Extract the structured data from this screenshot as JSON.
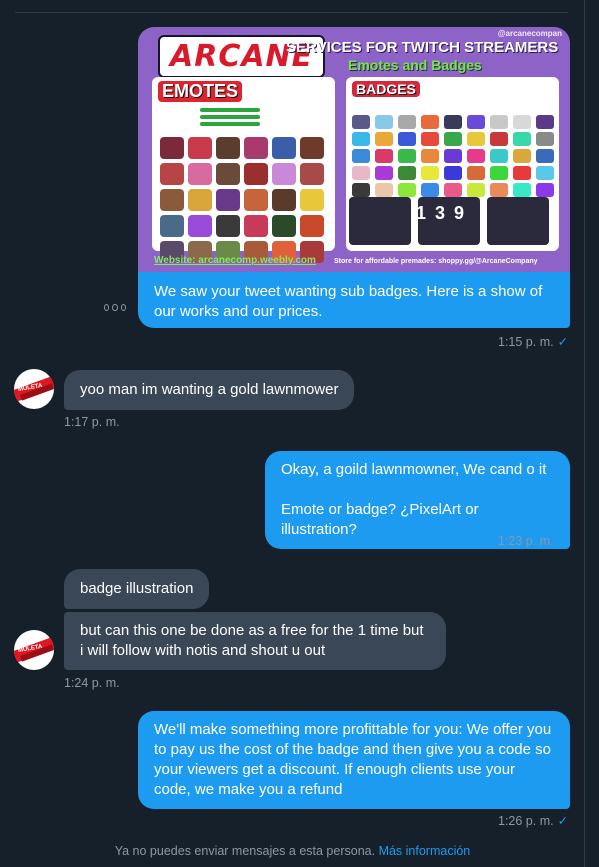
{
  "media": {
    "handle": "@arcanecompan",
    "logo_text": "ARCANE",
    "tagline": "SERVICES FOR TWITCH STREAMERS",
    "subtitle": "Emotes and Badges",
    "emotes_title": "EMOTES",
    "badges_title": "BADGES",
    "pack_numbers": "1 3 9",
    "website": "Website: arcanecomp.weebly.com",
    "store_note": "Store for affordable premades: shoppy.gg/@ArcaneCompany"
  },
  "conversation": [
    {
      "id": "m1",
      "sender": "me",
      "text": "We saw your tweet wanting sub badges. Here is a show of our works and our prices.",
      "time": "1:15 p. m."
    },
    {
      "id": "m2",
      "sender": "them",
      "text": "yoo man im wanting a gold lawnmower",
      "time": "1:17 p. m."
    },
    {
      "id": "m3",
      "sender": "me",
      "line1": "Okay, a goild lawnmowner, We cand o it",
      "line2": "Emote or badge? ¿PixelArt or illustration?",
      "time": "1:23 p. m."
    },
    {
      "id": "m4",
      "sender": "them",
      "text": "badge illustration"
    },
    {
      "id": "m5",
      "sender": "them",
      "text": "but can this one be done as a free for the 1 time but i will follow with notis and shout u out",
      "time": "1:24 p. m."
    },
    {
      "id": "m6",
      "sender": "me",
      "text": "We'll make something more profittable for you: We offer you to pay us the cost of the badge and then give you a code so your viewers get a discount. If enough clients use your code, we make you a refund",
      "time": "1:26 p. m."
    }
  ],
  "avatar_text": "MULETA",
  "read_check": "✓",
  "footer": {
    "text": "Ya no puedes enviar mensajes a esta persona.",
    "link": "Más información"
  },
  "colors": {
    "background": "#15202b",
    "outgoing_bubble": "#1d9bf0",
    "incoming_bubble": "#3a4756",
    "muted_text": "#8b98a5"
  }
}
